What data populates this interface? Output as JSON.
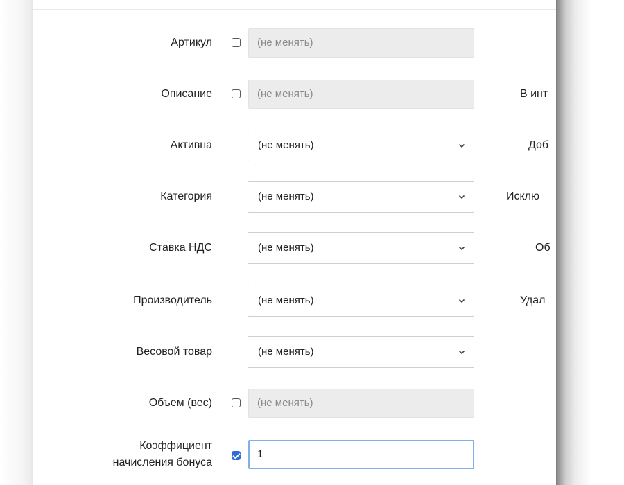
{
  "form": {
    "fields": [
      {
        "label": "Артикул",
        "kind": "checkbox-text",
        "checked": false,
        "value": "(не менять)"
      },
      {
        "label": "Описание",
        "kind": "checkbox-text",
        "checked": false,
        "value": "(не менять)"
      },
      {
        "label": "Активна",
        "kind": "select",
        "value": "(не менять)"
      },
      {
        "label": "Категория",
        "kind": "select",
        "value": "(не менять)"
      },
      {
        "label": "Ставка НДС",
        "kind": "select",
        "value": "(не менять)"
      },
      {
        "label": "Производитель",
        "kind": "select",
        "value": "(не менять)"
      },
      {
        "label": "Весовой товар",
        "kind": "select",
        "value": "(не менять)"
      },
      {
        "label": "Объем (вес)",
        "kind": "checkbox-text",
        "checked": false,
        "value": "(не менять)"
      },
      {
        "label_line1": "Коэффициент",
        "label_line2": "начисления бонуса",
        "kind": "checkbox-text",
        "checked": true,
        "value": "1"
      }
    ],
    "right_column": [
      "В инт",
      "Доб",
      "Исклю",
      "Об",
      "Удал"
    ]
  },
  "colors": {
    "checkbox_checked": "#2d6fd6",
    "disabled_input_bg": "#ececec",
    "active_input_border": "#7fb0ea"
  },
  "icons": {
    "select_arrow": "chevron-down-icon"
  }
}
